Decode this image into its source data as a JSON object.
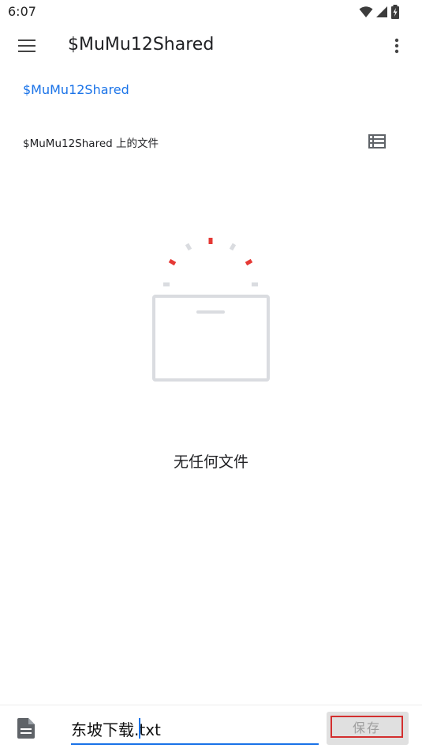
{
  "status_bar": {
    "time": "6:07",
    "icons": [
      "wifi-icon",
      "cell-signal-icon",
      "battery-icon"
    ]
  },
  "app_bar": {
    "title": "$MuMu12Shared",
    "menu_icon": "hamburger-menu-icon",
    "more_icon": "more-vert-icon"
  },
  "breadcrumb": {
    "current": "$MuMu12Shared"
  },
  "section": {
    "title": "$MuMu12Shared 上的文件",
    "view_icon": "list-view-icon"
  },
  "empty_state": {
    "message": "无任何文件",
    "icon": "empty-folder-icon"
  },
  "save_bar": {
    "file_icon": "document-icon",
    "filename": "东坡下载.txt",
    "save_label": "保存"
  },
  "colors": {
    "accent": "#1a73e8",
    "highlight": "#d32f2f",
    "disabled_text": "#9e9e9e"
  }
}
